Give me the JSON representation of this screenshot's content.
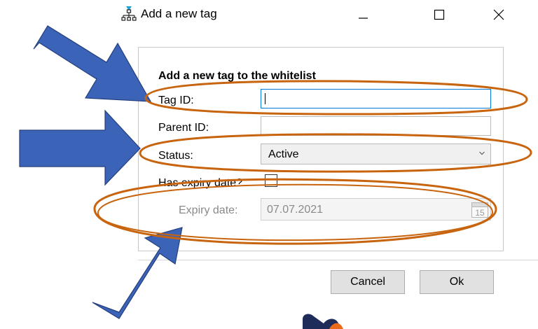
{
  "window": {
    "title": "Add a new tag",
    "icon": "network-tag-icon"
  },
  "form": {
    "heading": "Add a new tag to the whitelist",
    "tag_id_label": "Tag ID:",
    "tag_id_value": "",
    "parent_id_label": "Parent ID:",
    "parent_id_value": "",
    "status_label": "Status:",
    "status_value": "Active",
    "has_expiry_label": "Has expiry date?",
    "has_expiry_checked": false,
    "expiry_date_label": "Expiry date:",
    "expiry_date_value": "07.07.2021",
    "calendar_day": "15"
  },
  "buttons": {
    "cancel": "Cancel",
    "ok": "Ok"
  },
  "annotations": {
    "arrow_color": "#3b63b8",
    "ellipse_color": "#c8640e"
  }
}
